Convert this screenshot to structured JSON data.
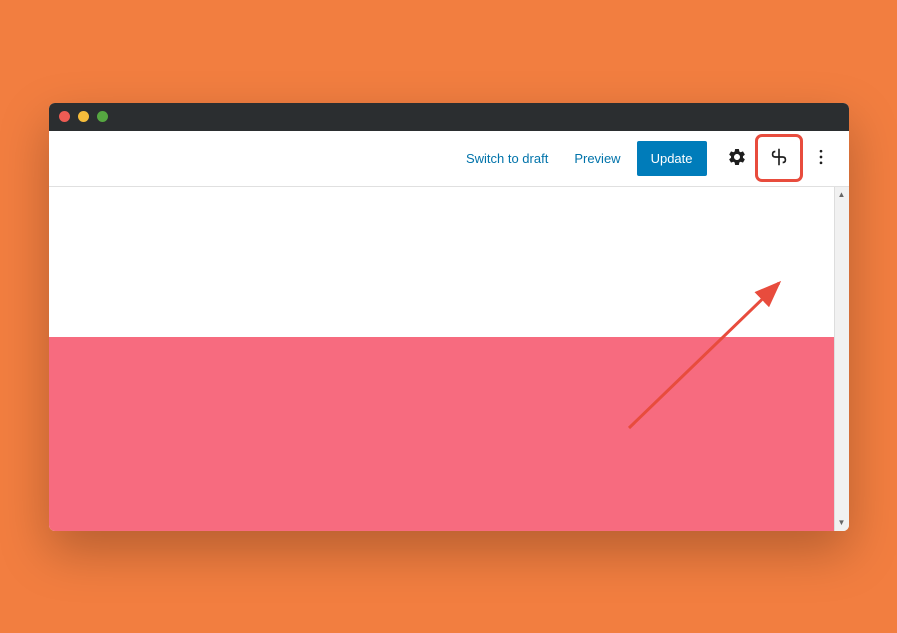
{
  "toolbar": {
    "switch_to_draft": "Switch to draft",
    "preview": "Preview",
    "update": "Update"
  },
  "annotation": {
    "highlight_color": "#e84c3d",
    "arrow_color": "#e84c3d"
  },
  "colors": {
    "background": "#f27e40",
    "pink_section": "#f76b7f",
    "primary_button": "#007cba",
    "link": "#0073aa"
  }
}
